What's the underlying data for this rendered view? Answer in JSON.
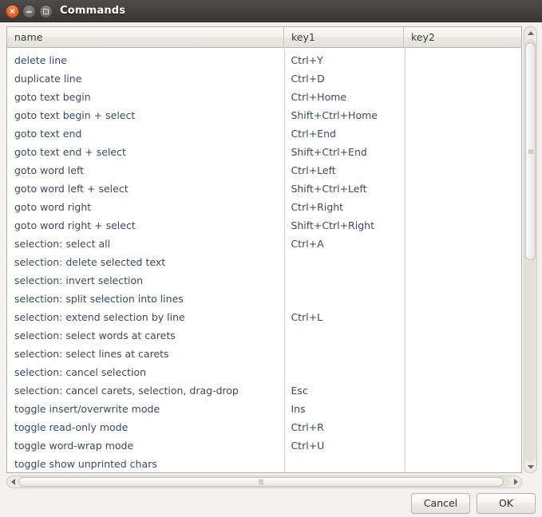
{
  "window": {
    "title": "Commands",
    "controls": {
      "close_label": "×",
      "minimize_name": "minimize",
      "maximize_name": "maximize"
    }
  },
  "list": {
    "columns": [
      {
        "key": "name",
        "label": "name"
      },
      {
        "key": "key1",
        "label": "key1"
      },
      {
        "key": "key2",
        "label": "key2"
      }
    ],
    "rows": [
      {
        "name": "delete line",
        "key1": "Ctrl+Y",
        "key2": ""
      },
      {
        "name": "duplicate line",
        "key1": "Ctrl+D",
        "key2": ""
      },
      {
        "name": "goto text begin",
        "key1": "Ctrl+Home",
        "key2": ""
      },
      {
        "name": "goto text begin + select",
        "key1": "Shift+Ctrl+Home",
        "key2": ""
      },
      {
        "name": "goto text end",
        "key1": "Ctrl+End",
        "key2": ""
      },
      {
        "name": "goto text end + select",
        "key1": "Shift+Ctrl+End",
        "key2": ""
      },
      {
        "name": "goto word left",
        "key1": "Ctrl+Left",
        "key2": ""
      },
      {
        "name": "goto word left + select",
        "key1": "Shift+Ctrl+Left",
        "key2": ""
      },
      {
        "name": "goto word right",
        "key1": "Ctrl+Right",
        "key2": ""
      },
      {
        "name": "goto word right + select",
        "key1": "Shift+Ctrl+Right",
        "key2": ""
      },
      {
        "name": "selection: select all",
        "key1": "Ctrl+A",
        "key2": ""
      },
      {
        "name": "selection: delete selected text",
        "key1": "",
        "key2": ""
      },
      {
        "name": "selection: invert selection",
        "key1": "",
        "key2": ""
      },
      {
        "name": "selection: split selection into lines",
        "key1": "",
        "key2": ""
      },
      {
        "name": "selection: extend selection by line",
        "key1": "Ctrl+L",
        "key2": ""
      },
      {
        "name": "selection: select words at carets",
        "key1": "",
        "key2": ""
      },
      {
        "name": "selection: select lines at carets",
        "key1": "",
        "key2": ""
      },
      {
        "name": "selection: cancel selection",
        "key1": "",
        "key2": ""
      },
      {
        "name": "selection: cancel carets, selection, drag-drop",
        "key1": "Esc",
        "key2": ""
      },
      {
        "name": "toggle insert/overwrite mode",
        "key1": "Ins",
        "key2": ""
      },
      {
        "name": "toggle read-only mode",
        "key1": "Ctrl+R",
        "key2": ""
      },
      {
        "name": "toggle word-wrap mode",
        "key1": "Ctrl+U",
        "key2": ""
      },
      {
        "name": "toggle show unprinted chars",
        "key1": "",
        "key2": ""
      }
    ]
  },
  "footer": {
    "cancel_label": "Cancel",
    "ok_label": "OK"
  },
  "colors": {
    "titlebar_dark": "#44403d",
    "close_button": "#e4672b",
    "row_text": "#3d4760",
    "window_bg": "#f2f1f0"
  }
}
